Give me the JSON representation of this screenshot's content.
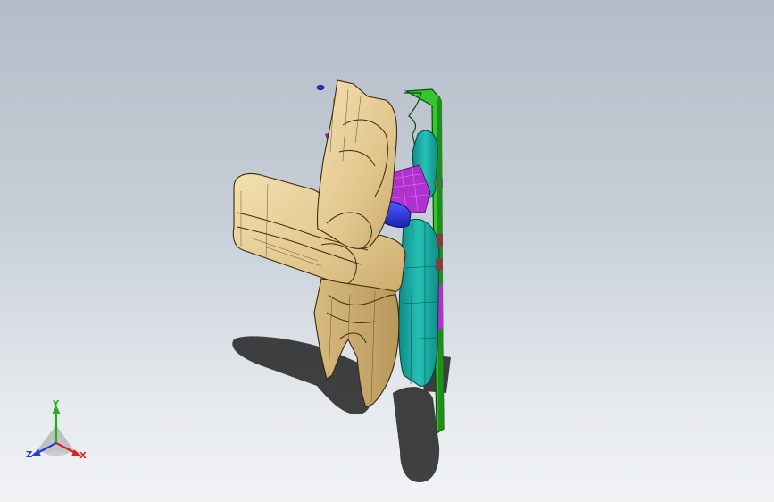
{
  "window": {
    "title": ""
  },
  "triad": {
    "x_label": "X",
    "y_label": "Y",
    "z_label": "Z",
    "x_color": "#e02020",
    "y_color": "#22b022",
    "z_color": "#2040e0"
  },
  "colors": {
    "background_top": "#b3bcc8",
    "background_bottom": "#f1f3f5",
    "beige_part": "#e6cc94",
    "green_board": "#33c92e",
    "cyan_part": "#1ca49c",
    "blue_ring": "#2a34e0",
    "magenta_part": "#b030d0"
  }
}
